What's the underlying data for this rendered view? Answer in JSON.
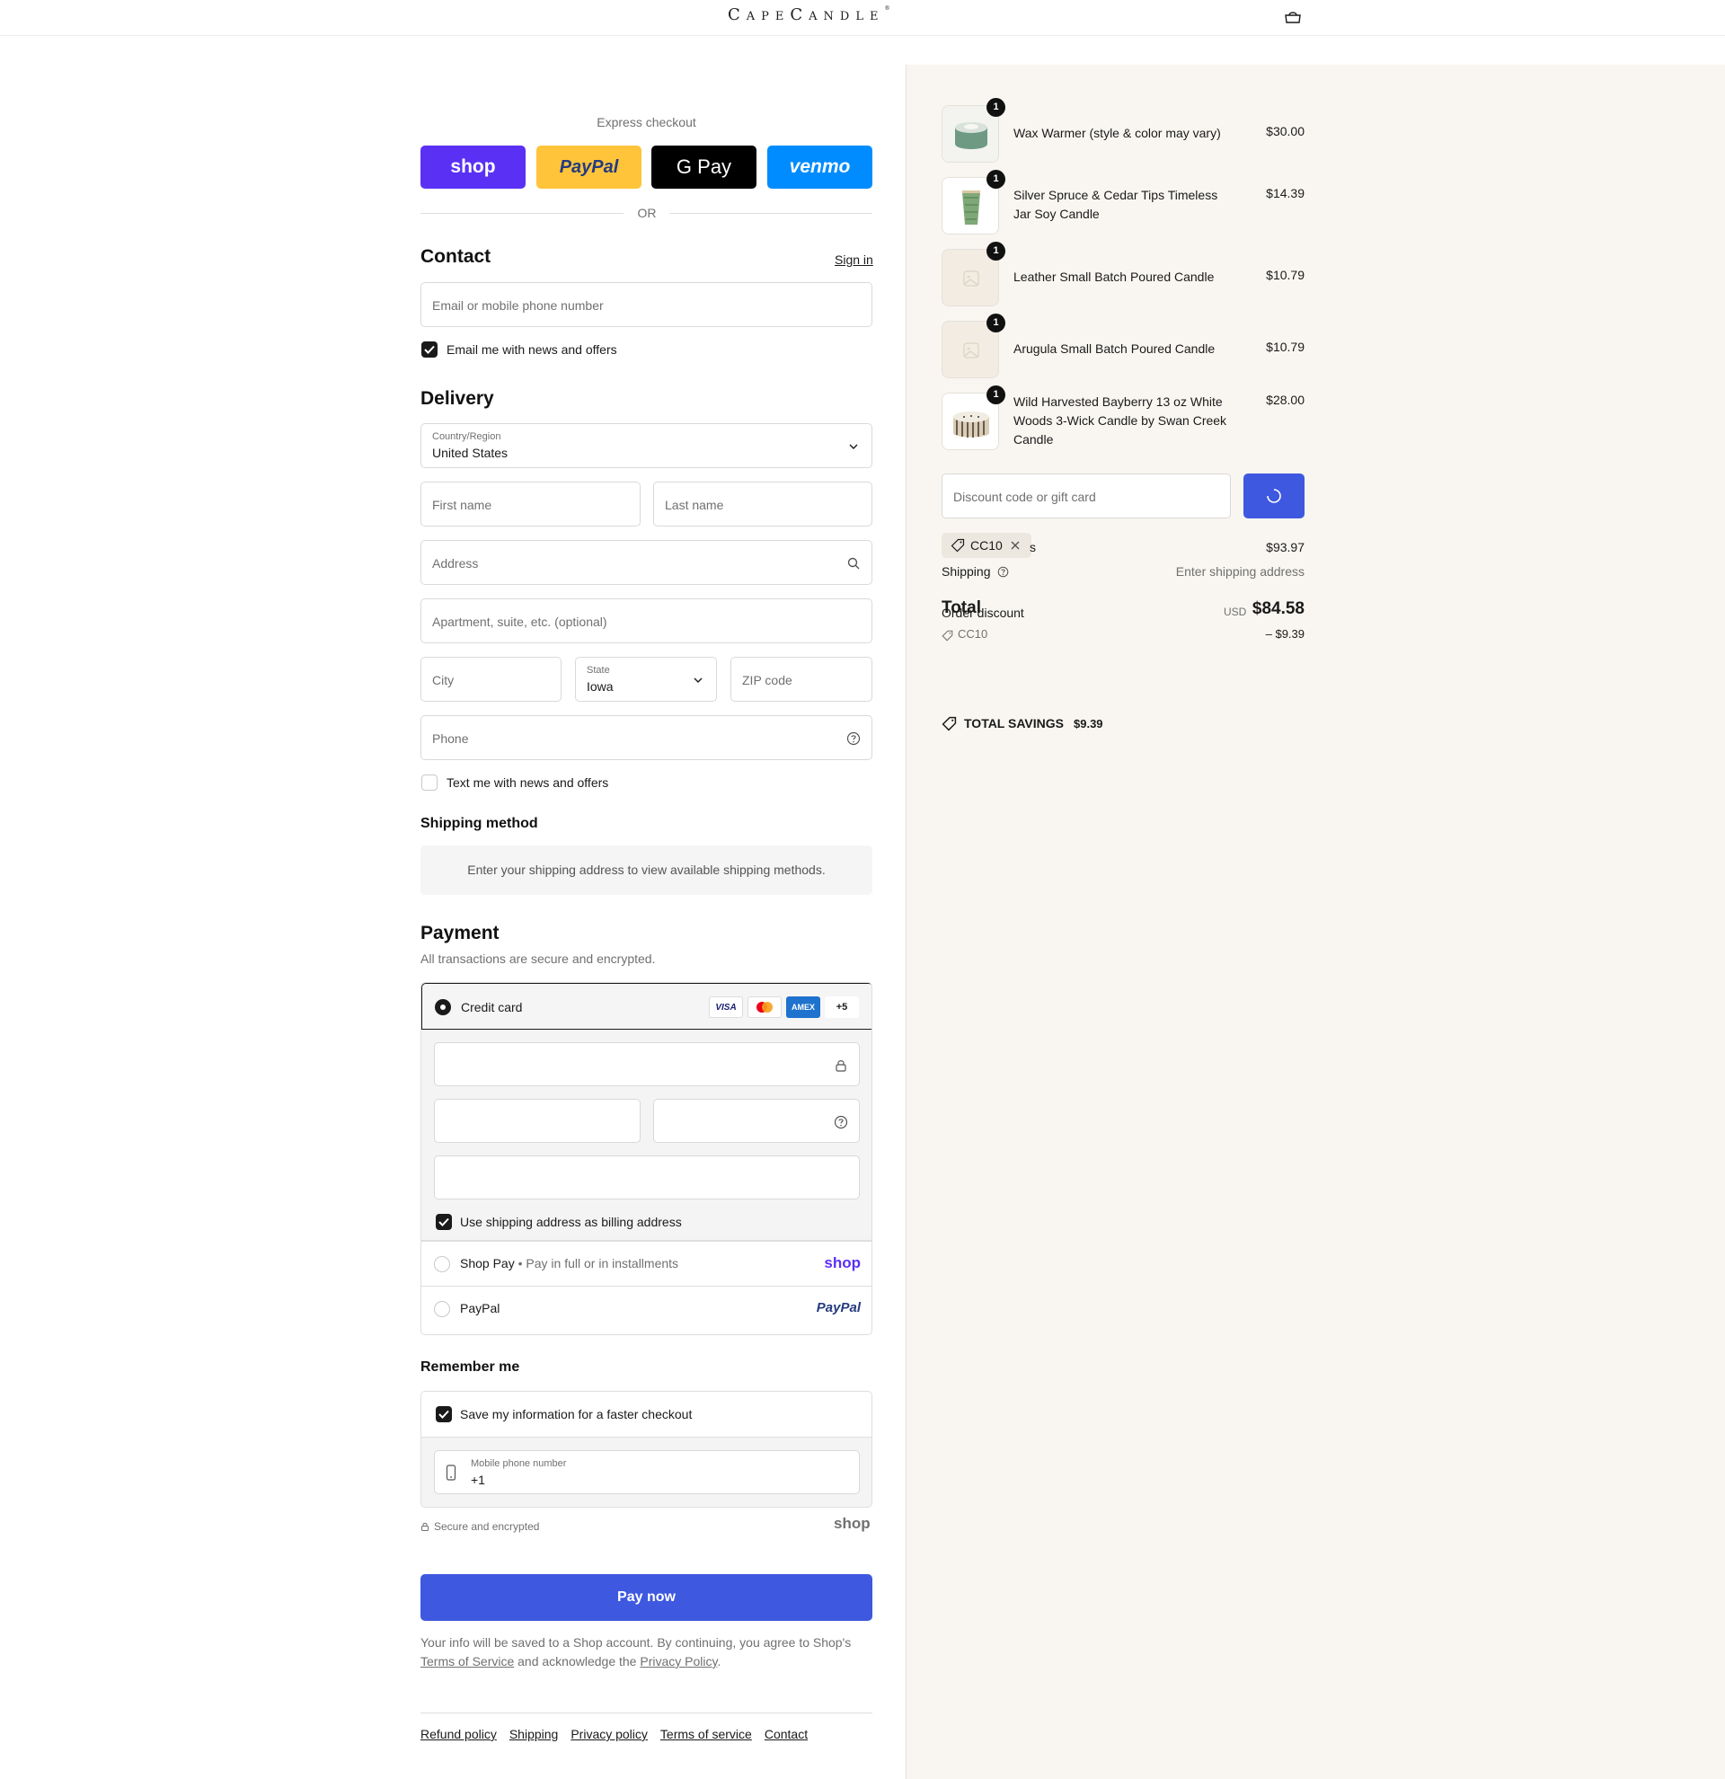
{
  "header": {
    "brand": "CapeCandle",
    "trademark": "®",
    "bag_icon": "bag-icon"
  },
  "express": {
    "title": "Express checkout",
    "buttons": [
      {
        "label": "shop",
        "color": "#5a31f4",
        "text_color": "#ffffff"
      },
      {
        "label": "PayPal",
        "color": "#ffc43a",
        "text_color": "#253b80"
      },
      {
        "label": "G Pay",
        "color": "#000000",
        "text_color": "#ffffff"
      },
      {
        "label": "venmo",
        "color": "#008cff",
        "text_color": "#ffffff"
      }
    ],
    "or": "OR"
  },
  "contact": {
    "heading": "Contact",
    "sign_in": "Sign in",
    "email_placeholder": "Email or mobile phone number",
    "news_label": "Email me with news and offers",
    "news_checked": true
  },
  "delivery": {
    "heading": "Delivery",
    "country_label": "Country/Region",
    "country_value": "United States",
    "first_name": "First name",
    "last_name": "Last name",
    "address": "Address",
    "apartment": "Apartment, suite, etc. (optional)",
    "city": "City",
    "state_label": "State",
    "state_value": "Iowa",
    "zip": "ZIP code",
    "phone": "Phone",
    "text_label": "Text me with news and offers",
    "text_checked": false
  },
  "shipping_method": {
    "heading": "Shipping method",
    "message": "Enter your shipping address to view available shipping methods."
  },
  "payment": {
    "heading": "Payment",
    "subheading": "All transactions are secure and encrypted.",
    "credit_card_label": "Credit card",
    "card_badges": [
      "VISA",
      "MC",
      "AMEX",
      "+5"
    ],
    "billing_label": "Use shipping address as billing address",
    "billing_checked": true,
    "shop_pay_label": "Shop Pay",
    "shop_pay_sub": "Pay in full or in installments",
    "shop_pay_logo": "shop",
    "paypal_label": "PayPal",
    "paypal_logo": "PayPal"
  },
  "remember": {
    "heading": "Remember me",
    "save_label": "Save my information for a faster checkout",
    "save_checked": true,
    "mobile_label": "Mobile phone number",
    "mobile_value": "+1",
    "secure_text": "Secure and encrypted",
    "shop_logo": "shop"
  },
  "pay_now": "Pay now",
  "legal": {
    "text1": "Your info will be saved to a Shop account. By continuing, you agree to Shop's",
    "terms": "Terms of Service",
    "text2": "and acknowledge the",
    "privacy": "Privacy Policy",
    "text3": "."
  },
  "footer_links": [
    "Refund policy",
    "Shipping",
    "Privacy policy",
    "Terms of service",
    "Contact"
  ],
  "order": {
    "items": [
      {
        "name": "Wax Warmer (style & color may vary)",
        "price": "$30.00",
        "qty": "1"
      },
      {
        "name": "Silver Spruce & Cedar Tips Timeless Jar Soy Candle",
        "price": "$14.39",
        "qty": "1"
      },
      {
        "name": "Leather Small Batch Poured Candle",
        "price": "$10.79",
        "qty": "1"
      },
      {
        "name": "Arugula Small Batch Poured Candle",
        "price": "$10.79",
        "qty": "1"
      },
      {
        "name": "Wild Harvested Bayberry 13 oz White Woods 3-Wick Candle by Swan Creek Candle",
        "price": "$28.00",
        "qty": "1"
      }
    ],
    "discount_placeholder": "Discount code or gift card",
    "applied_code": "CC10",
    "subtotal_fragment": "s",
    "subtotal_value": "$93.97",
    "shipping_label": "Shipping",
    "shipping_value": "Enter shipping address",
    "total_label": "Total",
    "order_discount_label": "Order discount",
    "currency": "USD",
    "total_value": "$84.58",
    "discount_code": "CC10",
    "discount_value": "– $9.39",
    "savings_label": "TOTAL SAVINGS",
    "savings_value": "$9.39"
  }
}
